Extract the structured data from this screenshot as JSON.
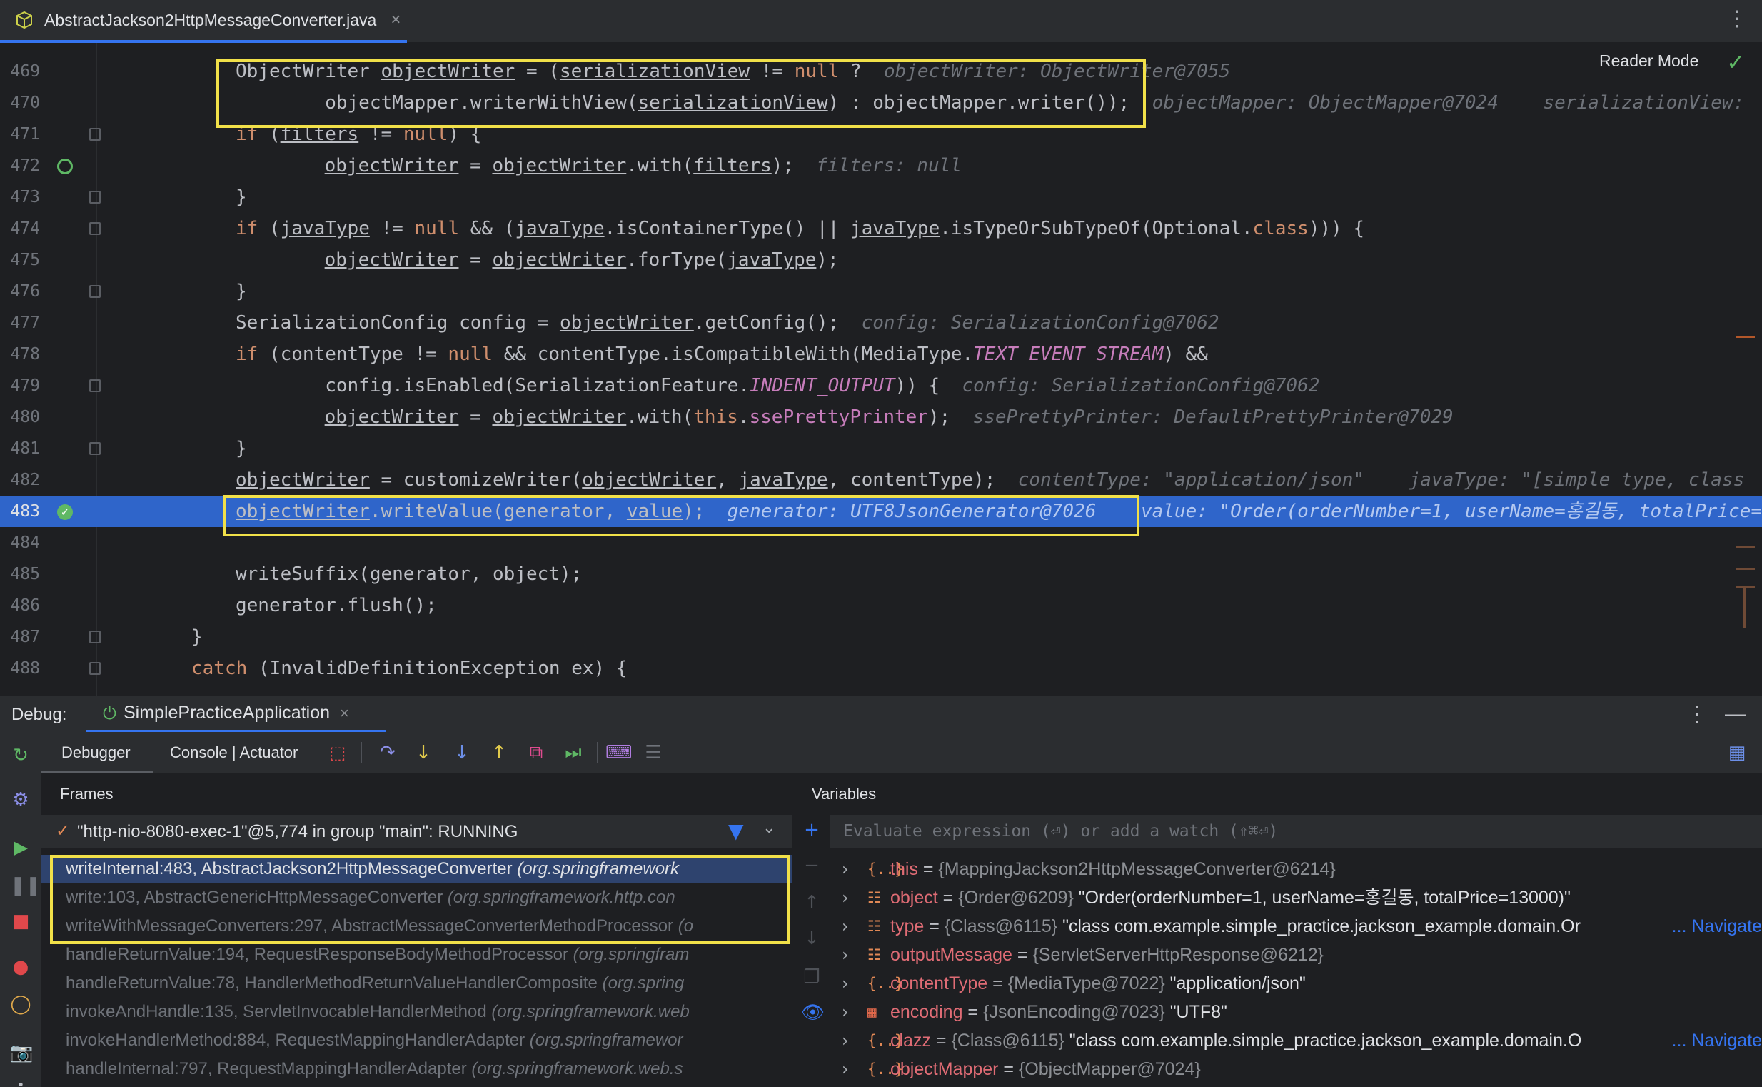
{
  "editor_tab": {
    "title": "AbstractJackson2HttpMessageConverter.java",
    "close": "×",
    "menu": "⋮"
  },
  "reader_mode": {
    "label": "Reader Mode",
    "check": "✓"
  },
  "code_lines": [
    {
      "num": "469",
      "html": "ObjectWriter <span class=\"ul\">objectWriter</span> = (<span class=\"ul\">serializationView</span> != <span class=\"kw\">null</span> ?  <span class=\"hint\">objectWriter: ObjectWriter@7055</span>"
    },
    {
      "num": "470",
      "html": "        objectMapper.writerWithView(<span class=\"ul\">serializationView</span>) : objectMapper.writer());  <span class=\"hint\">objectMapper: ObjectMapper@7024    serializationView:</span>"
    },
    {
      "num": "471",
      "html": "<span class=\"kw\">if</span> (<span class=\"ul\">filters</span> != <span class=\"kw\">null</span>) {"
    },
    {
      "num": "472",
      "html": "    <span class=\"ul\">objectWriter</span> = <span class=\"ul\">objectWriter</span>.with(<span class=\"ul\">filters</span>);  <span class=\"hint\">filters: null</span>"
    },
    {
      "num": "473",
      "html": "}"
    },
    {
      "num": "474",
      "html": "<span class=\"kw\">if</span> (<span class=\"ul\">javaType</span> != <span class=\"kw\">null</span> &amp;&amp; (<span class=\"ul\">javaType</span>.isContainerType() || <span class=\"ul\">javaType</span>.isTypeOrSubTypeOf(Optional.<span class=\"kw\">class</span>))) {"
    },
    {
      "num": "475",
      "html": "    <span class=\"ul\">objectWriter</span> = <span class=\"ul\">objectWriter</span>.forType(<span class=\"ul\">javaType</span>);"
    },
    {
      "num": "476",
      "html": "}"
    },
    {
      "num": "477",
      "html": "SerializationConfig config = <span class=\"ul\">objectWriter</span>.getConfig();  <span class=\"hint\">config: SerializationConfig@7062</span>"
    },
    {
      "num": "478",
      "html": "<span class=\"kw\">if</span> (contentType != <span class=\"kw\">null</span> &amp;&amp; contentType.isCompatibleWith(MediaType.<span class=\"fld\">TEXT_EVENT_STREAM</span>) &amp;&amp;"
    },
    {
      "num": "479",
      "html": "        config.isEnabled(SerializationFeature.<span class=\"fld\">INDENT_OUTPUT</span>)) {  <span class=\"hint\">config: SerializationConfig@7062</span>"
    },
    {
      "num": "480",
      "html": "    <span class=\"ul\">objectWriter</span> = <span class=\"ul\">objectWriter</span>.with(<span class=\"kw\">this</span>.<span class=\"fld\" style=\"font-style:normal\">ssePrettyPrinter</span>);  <span class=\"hint\">ssePrettyPrinter: DefaultPrettyPrinter@7029</span>"
    },
    {
      "num": "481",
      "html": "}"
    },
    {
      "num": "482",
      "html": "<span class=\"ul\">objectWriter</span> = customizeWriter(<span class=\"ul\">objectWriter</span>, <span class=\"ul\">javaType</span>, contentType);  <span class=\"hint\">contentType: \"application/json\"    javaType: \"[simple type, class</span>"
    },
    {
      "num": "483",
      "html": "<span class=\"ul\">objectWriter</span>.writeValue(generator, <span class=\"ul\">value</span>);  <span class=\"hint\">generator: UTF8JsonGenerator@7026</span>    <span class=\"hint\">value: \"Order(orderNumber=1, userName=홍길동, totalPrice=</span>"
    },
    {
      "num": "484",
      "html": ""
    },
    {
      "num": "485",
      "html": "writeSuffix(generator, object);"
    },
    {
      "num": "486",
      "html": "generator.flush();"
    },
    {
      "num": "487",
      "html": "}"
    },
    {
      "num": "488",
      "html": "<span class=\"kw\">catch</span> (InvalidDefinitionException ex) {"
    }
  ],
  "debug": {
    "label": "Debug:",
    "session": "SimplePracticeApplication",
    "tabs": [
      "Debugger",
      "Console | Actuator"
    ],
    "frames_title": "Frames",
    "variables_title": "Variables",
    "thread": "\"http-nio-8080-exec-1\"@5,774 in group \"main\": RUNNING",
    "eval_placeholder": "Evaluate expression (⏎) or add a watch (⇧⌘⏎)"
  },
  "frames": [
    {
      "method": "writeInternal:483, AbstractJackson2HttpMessageConverter",
      "pkg": "(org.springframework",
      "state": "selected"
    },
    {
      "method": "write:103, AbstractGenericHttpMessageConverter",
      "pkg": "(org.springframework.http.con",
      "state": "library"
    },
    {
      "method": "writeWithMessageConverters:297, AbstractMessageConverterMethodProcessor",
      "pkg": "(o",
      "state": "library"
    },
    {
      "method": "handleReturnValue:194, RequestResponseBodyMethodProcessor",
      "pkg": "(org.springfram",
      "state": "library"
    },
    {
      "method": "handleReturnValue:78, HandlerMethodReturnValueHandlerComposite",
      "pkg": "(org.spring",
      "state": "library"
    },
    {
      "method": "invokeAndHandle:135, ServletInvocableHandlerMethod",
      "pkg": "(org.springframework.web",
      "state": "library"
    },
    {
      "method": "invokeHandlerMethod:884, RequestMappingHandlerAdapter",
      "pkg": "(org.springframewor",
      "state": "library"
    },
    {
      "method": "handleInternal:797, RequestMappingHandlerAdapter",
      "pkg": "(org.springframework.web.s",
      "state": "library"
    }
  ],
  "variables": [
    {
      "icon": "{..}",
      "icon_color": "#e08855",
      "name": "this",
      "type": "{MappingJackson2HttpMessageConverter@6214}",
      "value": "",
      "nav": ""
    },
    {
      "icon": "☷",
      "icon_color": "#e08855",
      "name": "object",
      "type": "{Order@6209}",
      "value": "\"Order(orderNumber=1, userName=홍길동, totalPrice=13000)\"",
      "nav": ""
    },
    {
      "icon": "☷",
      "icon_color": "#e08855",
      "name": "type",
      "type": "{Class@6115}",
      "value": "\"class com.example.simple_practice.jackson_example.domain.Or",
      "nav": "... Navigate"
    },
    {
      "icon": "☷",
      "icon_color": "#e08855",
      "name": "outputMessage",
      "type": "{ServletServerHttpResponse@6212}",
      "value": "",
      "nav": ""
    },
    {
      "icon": "{..}",
      "icon_color": "#e08855",
      "name": "contentType",
      "type": "{MediaType@7022}",
      "value": "\"application/json\"",
      "nav": ""
    },
    {
      "icon": "▦",
      "icon_color": "#e0684b",
      "name": "encoding",
      "type": "{JsonEncoding@7023}",
      "value": "\"UTF8\"",
      "nav": ""
    },
    {
      "icon": "{..}",
      "icon_color": "#e08855",
      "name": "clazz",
      "type": "{Class@6115}",
      "value": "\"class com.example.simple_practice.jackson_example.domain.O",
      "nav": "... Navigate"
    },
    {
      "icon": "{..}",
      "icon_color": "#e08855",
      "name": "objectMapper",
      "type": "{ObjectMapper@7024}",
      "value": "",
      "nav": ""
    }
  ]
}
